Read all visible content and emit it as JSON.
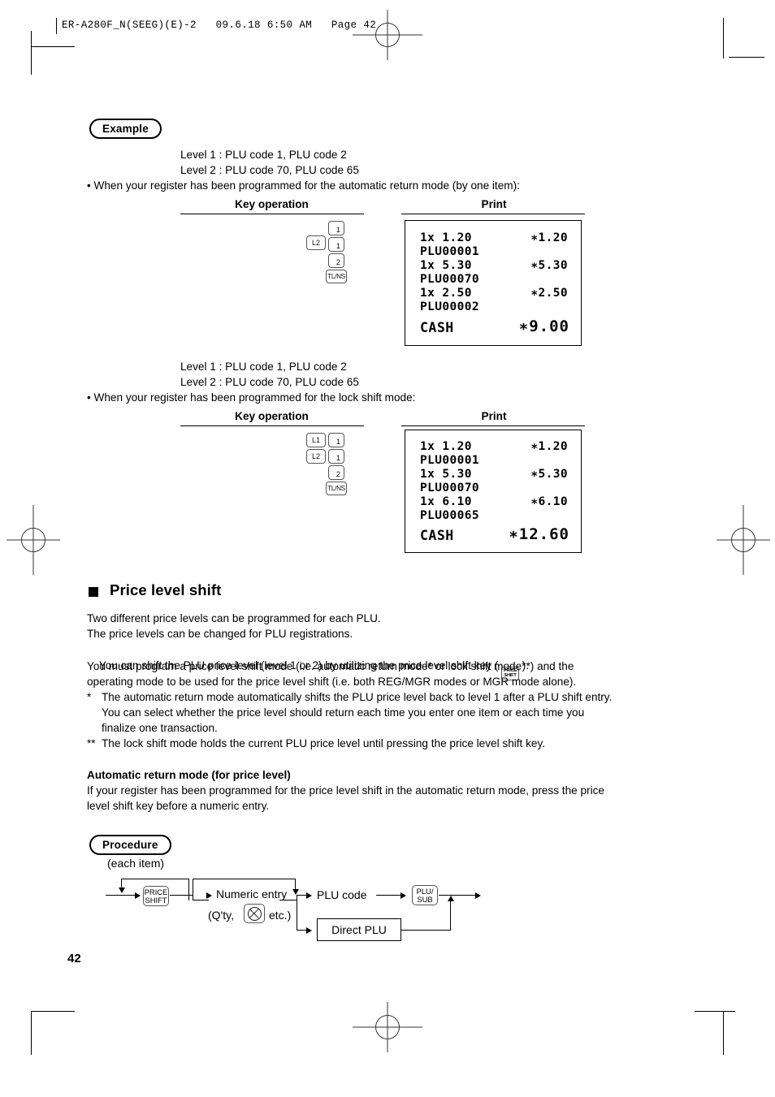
{
  "header": {
    "file_line": "ER-A280F_N(SEEG)(E)-2   09.6.18 6:50 AM   Page 42"
  },
  "example": {
    "badge": "Example",
    "case1": {
      "level1": "Level 1 : PLU code 1, PLU code 2",
      "level2": "Level 2 : PLU code 70, PLU code 65",
      "condition": "• When your register has been programmed for the automatic return mode (by one item):",
      "col_key": "Key operation",
      "col_print": "Print",
      "keys": {
        "shift": "L2",
        "num1": "1",
        "num2": "1",
        "num3": "2",
        "total": "TL/NS"
      },
      "receipt": {
        "lines": [
          {
            "left": "1x 1.20",
            "right": "∗1.20"
          },
          {
            "left": "PLU00001",
            "right": ""
          },
          {
            "left": "1x 5.30",
            "right": "∗5.30"
          },
          {
            "left": "PLU00070",
            "right": ""
          },
          {
            "left": "1x 2.50",
            "right": "∗2.50"
          },
          {
            "left": "PLU00002",
            "right": ""
          }
        ],
        "total_label": "CASH",
        "total_value": "∗9.00"
      }
    },
    "case2": {
      "level1": "Level 1 : PLU code 1, PLU code 2",
      "level2": "Level 2 : PLU code 70, PLU code 65",
      "condition": "• When your register has been programmed for the lock shift mode:",
      "col_key": "Key operation",
      "col_print": "Print",
      "keys": {
        "shift1": "L1",
        "shift2": "L2",
        "num1": "1",
        "num2": "1",
        "num3": "2",
        "total": "TL/NS"
      },
      "receipt": {
        "lines": [
          {
            "left": "1x 1.20",
            "right": "∗1.20"
          },
          {
            "left": "PLU00001",
            "right": ""
          },
          {
            "left": "1x 5.30",
            "right": "∗5.30"
          },
          {
            "left": "PLU00070",
            "right": ""
          },
          {
            "left": "1x 6.10",
            "right": "∗6.10"
          },
          {
            "left": "PLU00065",
            "right": ""
          }
        ],
        "total_label": "CASH",
        "total_value": "∗12.60"
      }
    }
  },
  "section": {
    "title": "Price level shift",
    "p1": "Two different price levels can be programmed for each PLU.",
    "p2": "The price levels can be changed for PLU registrations.",
    "p3_pre": "You can shift the PLU price level (level 1 or 2) by utilizing the price level shift key ( ",
    "p3_key_top": "PRICE",
    "p3_key_bottom": "SHIFT",
    "p3_post": " ).",
    "p4": "You must program a price level shift mode (i.e. automatic return mode* or lock shift mode**) and the",
    "p5": "operating mode to be used for the price level shift (i.e. both REG/MGR modes or MGR mode alone).",
    "note1_mark": "*",
    "note1_l1": "The automatic return mode automatically shifts the PLU price level back to level 1 after a PLU shift entry.",
    "note1_l2": "You can select whether the price level should return each time you enter one item or each time you",
    "note1_l3": "finalize one transaction.",
    "note2_mark": "**",
    "note2_l1": "The lock shift mode holds the current PLU price level until pressing the price level shift key."
  },
  "auto_return": {
    "heading": "Automatic return mode (for price level)",
    "line1": "If your register has been programmed for the price level shift in the automatic return mode, press the price",
    "line2": "level shift key before a numeric entry."
  },
  "procedure": {
    "badge": "Procedure",
    "each_item": "(each item)",
    "price_shift_top": "PRICE",
    "price_shift_bottom": "SHIFT",
    "numeric_entry": "Numeric entry",
    "qty_pre": "(Q'ty,",
    "qty_post": "etc.)",
    "multiply_icon": "multiply-key-icon",
    "plu_code": "PLU code",
    "plu_sub_top": "PLU/",
    "plu_sub_bottom": "SUB",
    "direct_plu": "Direct PLU"
  },
  "page_number": "42"
}
